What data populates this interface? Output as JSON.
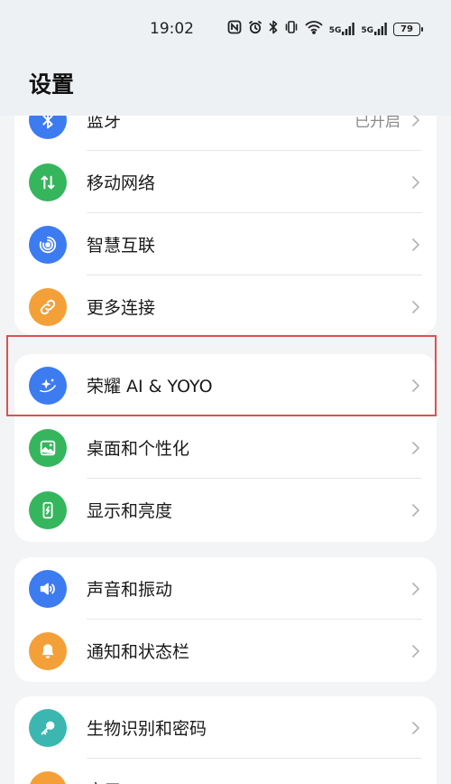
{
  "status_bar": {
    "time": "19:02",
    "net_5g_a": "5G",
    "net_5g_b": "5G",
    "battery": "79"
  },
  "header": {
    "title": "设置"
  },
  "groups": [
    {
      "items": [
        {
          "label": "蓝牙",
          "status": "已开启",
          "icon": "bluetooth-icon",
          "color": "#3d7bf0"
        },
        {
          "label": "移动网络",
          "icon": "mobile-data-icon",
          "color": "#35b55c"
        },
        {
          "label": "智慧互联",
          "icon": "smart-connect-icon",
          "color": "#3d7bf0"
        },
        {
          "label": "更多连接",
          "icon": "link-icon",
          "color": "#f4a038"
        }
      ]
    },
    {
      "items": [
        {
          "label": "荣耀 AI & YOYO",
          "icon": "sparkle-icon",
          "color": "#3d7bf0"
        },
        {
          "label": "桌面和个性化",
          "icon": "wallpaper-icon",
          "color": "#35b55c"
        },
        {
          "label": "显示和亮度",
          "icon": "display-icon",
          "color": "#35b55c"
        }
      ]
    },
    {
      "items": [
        {
          "label": "声音和振动",
          "icon": "speaker-icon",
          "color": "#3d7bf0"
        },
        {
          "label": "通知和状态栏",
          "icon": "bell-icon",
          "color": "#f4a038"
        }
      ]
    },
    {
      "items": [
        {
          "label": "生物识别和密码",
          "icon": "key-icon",
          "color": "#3bb6b0"
        },
        {
          "label": "应用",
          "icon": "apps-icon",
          "color": "#f4a038"
        }
      ]
    }
  ]
}
